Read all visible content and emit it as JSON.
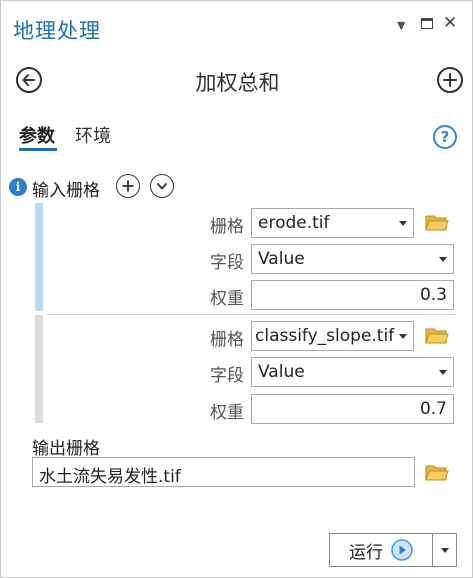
{
  "window": {
    "title": "地理处理"
  },
  "tool": {
    "title": "加权总和"
  },
  "tabs": [
    {
      "label": "参数",
      "active": true
    },
    {
      "label": "环境",
      "active": false
    }
  ],
  "inputs": {
    "label": "输入栅格",
    "rows": [
      {
        "raster_label": "栅格",
        "raster_value": "erode.tif",
        "field_label": "字段",
        "field_value": "Value",
        "weight_label": "权重",
        "weight_value": "0.3"
      },
      {
        "raster_label": "栅格",
        "raster_value": "classify_slope.tif",
        "field_label": "字段",
        "field_value": "Value",
        "weight_label": "权重",
        "weight_value": "0.7"
      }
    ]
  },
  "output": {
    "label": "输出栅格",
    "value": "水土流失易发性.tif"
  },
  "run": {
    "label": "运行"
  },
  "colors": {
    "accent": "#1f6fb5",
    "folder": "#e6b73c",
    "selected_bar": "#bfd9ec",
    "unselected_bar": "#dcdcdc"
  }
}
